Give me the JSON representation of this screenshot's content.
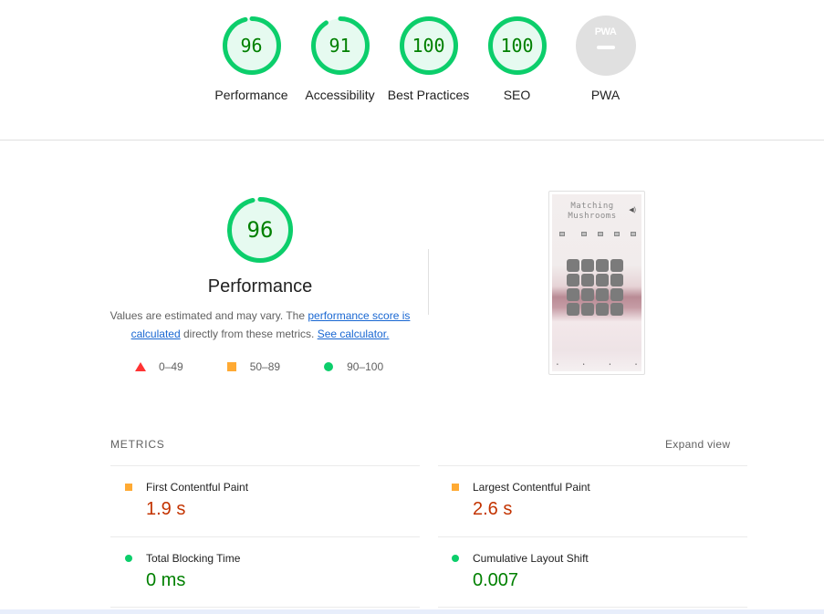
{
  "colors": {
    "pass": "#0cce6b",
    "pass_text": "#008000",
    "average": "#ffaa33",
    "average_text": "#c33300",
    "fail": "#ff3333",
    "link": "#1967d2",
    "pwa_gray": "#e0e0e0"
  },
  "categories": [
    {
      "score": "96",
      "score_value": 96,
      "label": "Performance"
    },
    {
      "score": "91",
      "score_value": 91,
      "label": "Accessibility"
    },
    {
      "score": "100",
      "score_value": 100,
      "label": "Best Practices"
    },
    {
      "score": "100",
      "score_value": 100,
      "label": "SEO"
    },
    {
      "label": "PWA",
      "badge": "PWA"
    }
  ],
  "performance": {
    "score": "96",
    "score_value": 96,
    "title": "Performance",
    "desc_prefix": "Values are estimated and may vary. The ",
    "score_link": "performance score is calculated",
    "desc_middle": " directly from these metrics. ",
    "calc_link": "See calculator.",
    "legend": {
      "fail": "0–49",
      "average": "50–89",
      "pass": "90–100"
    }
  },
  "screenshot": {
    "title_line1": "Matching",
    "title_line2": "Mushrooms",
    "speaker_icon": "speaker-icon"
  },
  "metrics": {
    "heading": "METRICS",
    "expand_label": "Expand view",
    "items": [
      {
        "name": "First Contentful Paint",
        "value": "1.9 s",
        "rating": "average"
      },
      {
        "name": "Largest Contentful Paint",
        "value": "2.6 s",
        "rating": "average"
      },
      {
        "name": "Total Blocking Time",
        "value": "0 ms",
        "rating": "pass"
      },
      {
        "name": "Cumulative Layout Shift",
        "value": "0.007",
        "rating": "pass"
      }
    ]
  }
}
